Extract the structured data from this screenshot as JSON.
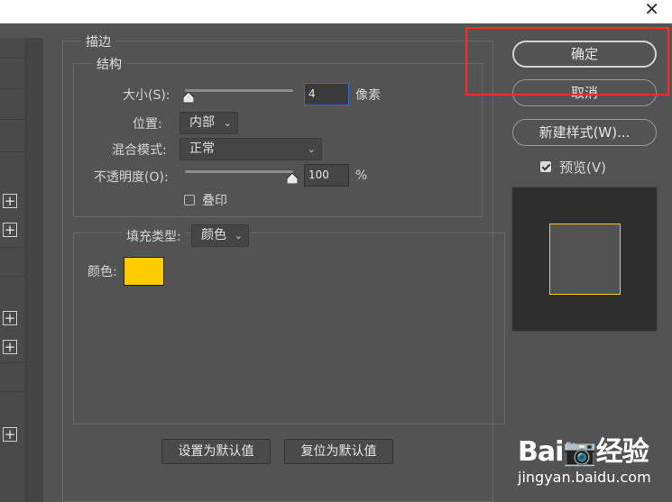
{
  "window": {
    "close_glyph": "✕"
  },
  "left_panel": {
    "plus_icons": 5
  },
  "stroke": {
    "title": "描边",
    "structure": {
      "title": "结构",
      "size_label": "大小(S):",
      "size_value": "4",
      "size_unit": "像素",
      "position_label": "位置:",
      "position_value": "内部",
      "blend_label": "混合模式:",
      "blend_value": "正常",
      "opacity_label": "不透明度(O):",
      "opacity_value": "100",
      "opacity_unit": "%",
      "opacity_fraction": 1.0,
      "size_fraction": 0.02,
      "overprint_label": "叠印",
      "overprint_checked": false
    },
    "fill": {
      "type_label": "填充类型:",
      "type_value": "颜色",
      "color_label": "颜色:",
      "color": "#ffcc00"
    },
    "set_default": "设置为默认值",
    "reset_default": "复位为默认值"
  },
  "side": {
    "ok": "确定",
    "cancel": "取消",
    "new_style": "新建样式(W)...",
    "preview_label": "预览(V)",
    "preview_checked": true
  },
  "highlight_color": "#ff2a2a",
  "watermark": {
    "logo": "Bai📷经验",
    "sub": "jingyan.baidu.com"
  }
}
